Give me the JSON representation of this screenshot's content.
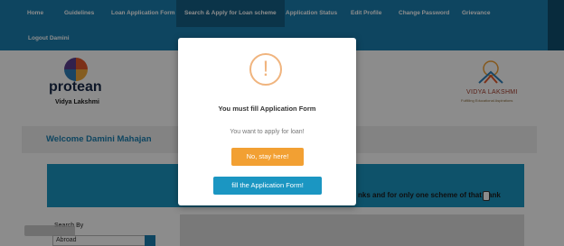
{
  "nav": {
    "items": [
      "Home",
      "Guidelines",
      "Loan Application Form",
      "Search & Apply for Loan scheme",
      "Application Status",
      "Edit Profile",
      "Change Password",
      "Grievance"
    ],
    "logout": "Logout Damini"
  },
  "brand": {
    "protean": "protean",
    "protean_sub": "Vidya Lakshmi",
    "vl_name": "VIDYA LAKSHMI",
    "vl_tagline": "Fulfilling Educational Aspirations"
  },
  "main": {
    "welcome": "Welcome Damini Mahajan",
    "scheme_note": "nks and for only one scheme of that bank",
    "search_label": "Search By",
    "search_value": "Abroad"
  },
  "modal": {
    "title": "You must fill Application Form",
    "text": "You want to apply for loan!",
    "stay_button": "No, stay here!",
    "fill_button": "fill the Application Form!",
    "icon": "exclamation-icon",
    "accent_color": "#f2a033",
    "primary_color": "#1b96c2"
  }
}
